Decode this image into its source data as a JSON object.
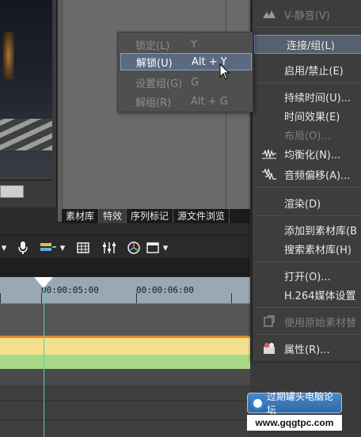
{
  "asset_tabs": [
    "素材库",
    "特效",
    "序列标记",
    "源文件浏览"
  ],
  "ruler": {
    "timecodes": [
      "00:00:05:00",
      "00:00:06:00"
    ]
  },
  "submenu": {
    "items": [
      {
        "label": "锁定(L)",
        "shortcut": "Y",
        "state": "disabled"
      },
      {
        "label": "解锁(U)",
        "shortcut": "Alt + Y",
        "state": "highlighted"
      },
      {
        "label": "设置组(G)",
        "shortcut": "G",
        "state": "disabled"
      },
      {
        "label": "解组(R)",
        "shortcut": "Alt + G",
        "state": "disabled"
      }
    ]
  },
  "context_menu": {
    "items": [
      {
        "label": "V-静音(V)",
        "icon": "mute-icon",
        "state": "disabled"
      },
      {
        "label": "连接/组(L)",
        "icon": "",
        "state": "highlighted"
      },
      {
        "label": "启用/禁止(E)",
        "icon": "",
        "state": "enabled"
      },
      {
        "label": "持续时间(U)...",
        "icon": "",
        "state": "enabled"
      },
      {
        "label": "时间效果(E)",
        "icon": "",
        "state": "enabled"
      },
      {
        "label": "布局(O)...",
        "icon": "",
        "state": "disabled"
      },
      {
        "label": "均衡化(N)...",
        "icon": "waveform-icon",
        "state": "enabled"
      },
      {
        "label": "音频偏移(A)...",
        "icon": "audio-offset-icon",
        "state": "enabled"
      },
      {
        "label": "渲染(D)",
        "icon": "",
        "state": "enabled"
      },
      {
        "label": "添加到素材库(B",
        "icon": "",
        "state": "enabled"
      },
      {
        "label": "搜索素材库(H)",
        "icon": "",
        "state": "enabled"
      },
      {
        "label": "打开(O)...",
        "icon": "",
        "state": "enabled"
      },
      {
        "label": "H.264媒体设置",
        "icon": "",
        "state": "enabled"
      },
      {
        "label": "使用原始素材替",
        "icon": "replace-clip-icon",
        "state": "disabled"
      },
      {
        "label": "属性(R)...",
        "icon": "properties-icon",
        "state": "enabled"
      }
    ]
  },
  "watermark": {
    "title": "过期罐头电脑论坛",
    "url": "www.gqgtpc.com"
  },
  "colors": {
    "menu_bg": "#3d3d3d",
    "highlight": "#56606e",
    "playhead": "#3fd6c8",
    "track_yellow": "#f4e08e",
    "track_green": "#a8d987"
  }
}
